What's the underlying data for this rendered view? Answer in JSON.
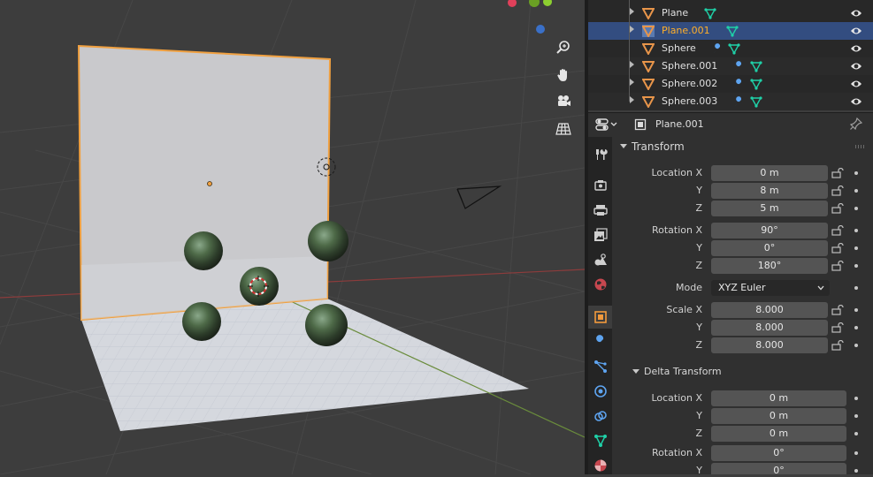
{
  "outliner": {
    "rows": [
      {
        "name": "Plane",
        "selected": false
      },
      {
        "name": "Plane.001",
        "selected": true
      },
      {
        "name": "Sphere",
        "selected": false
      },
      {
        "name": "Sphere.001",
        "selected": false
      },
      {
        "name": "Sphere.002",
        "selected": false
      },
      {
        "name": "Sphere.003",
        "selected": false
      }
    ]
  },
  "properties": {
    "header_object_name": "Plane.001",
    "transform": {
      "title": "Transform",
      "location": {
        "label_x": "Location X",
        "label_y": "Y",
        "label_z": "Z",
        "x": "0 m",
        "y": "8 m",
        "z": "5 m"
      },
      "rotation": {
        "label_x": "Rotation X",
        "label_y": "Y",
        "label_z": "Z",
        "x": "90°",
        "y": "0°",
        "z": "180°"
      },
      "mode": {
        "label": "Mode",
        "value": "XYZ Euler"
      },
      "scale": {
        "label_x": "Scale X",
        "label_y": "Y",
        "label_z": "Z",
        "x": "8.000",
        "y": "8.000",
        "z": "8.000"
      }
    },
    "delta_transform": {
      "title": "Delta Transform",
      "location": {
        "label_x": "Location X",
        "label_y": "Y",
        "label_z": "Z",
        "x": "0 m",
        "y": "0 m",
        "z": "0 m"
      },
      "rotation": {
        "label_x": "Rotation X",
        "label_y": "Y",
        "x": "0°",
        "y": "0°"
      }
    }
  },
  "colors": {
    "selection_outline": "#f0a040",
    "outliner_selected_bg": "#334d80",
    "selected_name": "#ffaf29",
    "mesh_icon": "#1fd1a8",
    "object_icon": "#e8954a",
    "modifier_icon": "#5ea4f0"
  },
  "icons": {
    "viewport_tools": [
      "zoom-icon",
      "hand-pan-icon",
      "camera-view-icon",
      "grid-ortho-icon"
    ],
    "property_tabs": [
      "tool-icon",
      "render-icon",
      "output-icon",
      "view-layer-icon",
      "scene-icon",
      "world-icon",
      "object-icon",
      "modifier-icon",
      "particles-icon",
      "physics-icon",
      "constraints-icon",
      "data-icon",
      "material-icon"
    ]
  }
}
